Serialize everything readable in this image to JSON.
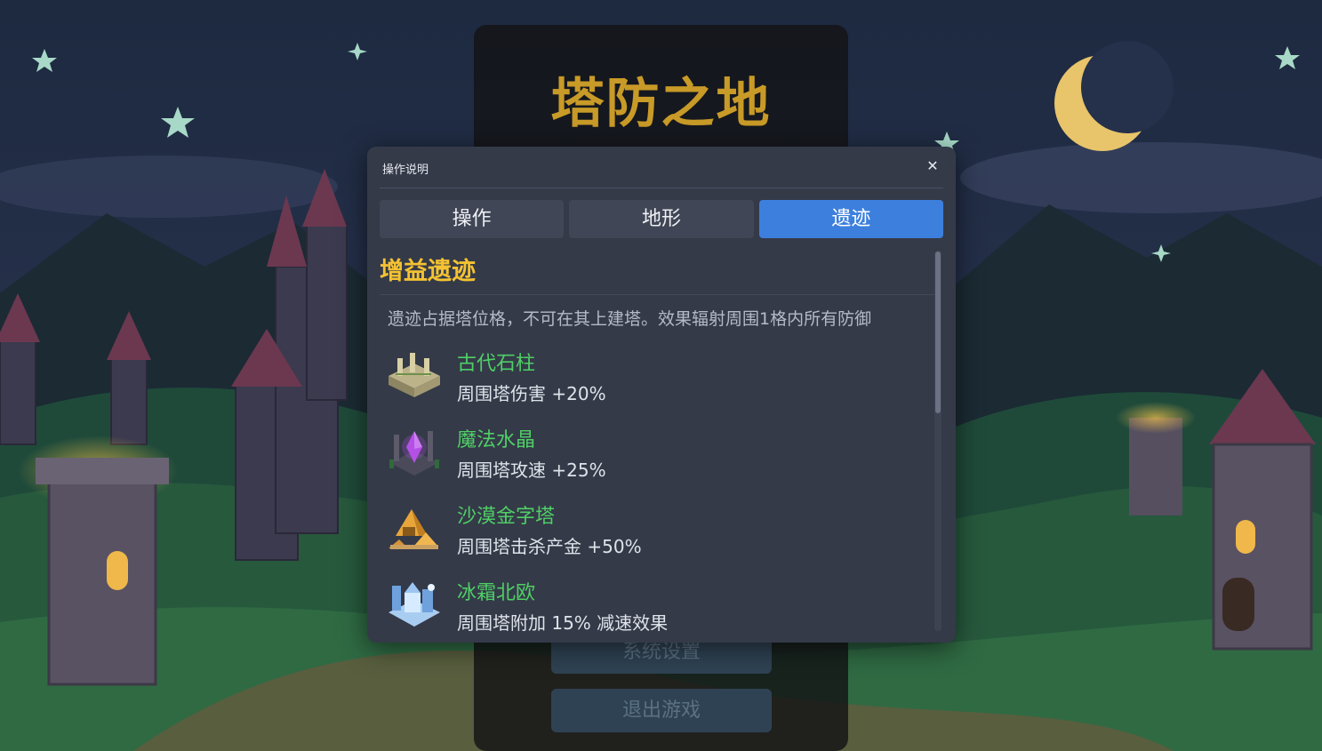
{
  "game": {
    "title": "塔防之地",
    "menu_buttons": [
      "系统设置",
      "退出游戏"
    ]
  },
  "dialog": {
    "title": "操作说明",
    "close_glyph": "✕",
    "tabs": [
      {
        "label": "操作",
        "active": false
      },
      {
        "label": "地形",
        "active": false
      },
      {
        "label": "遗迹",
        "active": true
      }
    ],
    "section_title": "增益遗迹",
    "description": "遗迹占据塔位格，不可在其上建塔。效果辐射周围1格内所有防御",
    "ruins": [
      {
        "name": "古代石柱",
        "effect": "周围塔伤害 +20%",
        "icon": "ancient-pillar-icon"
      },
      {
        "name": "魔法水晶",
        "effect": "周围塔攻速 +25%",
        "icon": "magic-crystal-icon"
      },
      {
        "name": "沙漠金字塔",
        "effect": "周围塔击杀产金 +50%",
        "icon": "desert-pyramid-icon"
      },
      {
        "name": "冰霜北欧",
        "effect": "周围塔附加 15% 减速效果",
        "icon": "frost-nordic-icon"
      }
    ]
  },
  "colors": {
    "accent": "#3d7fdd",
    "section_title": "#f4c232",
    "ruin_name": "#4fcf66",
    "dialog_bg": "#343a48"
  }
}
